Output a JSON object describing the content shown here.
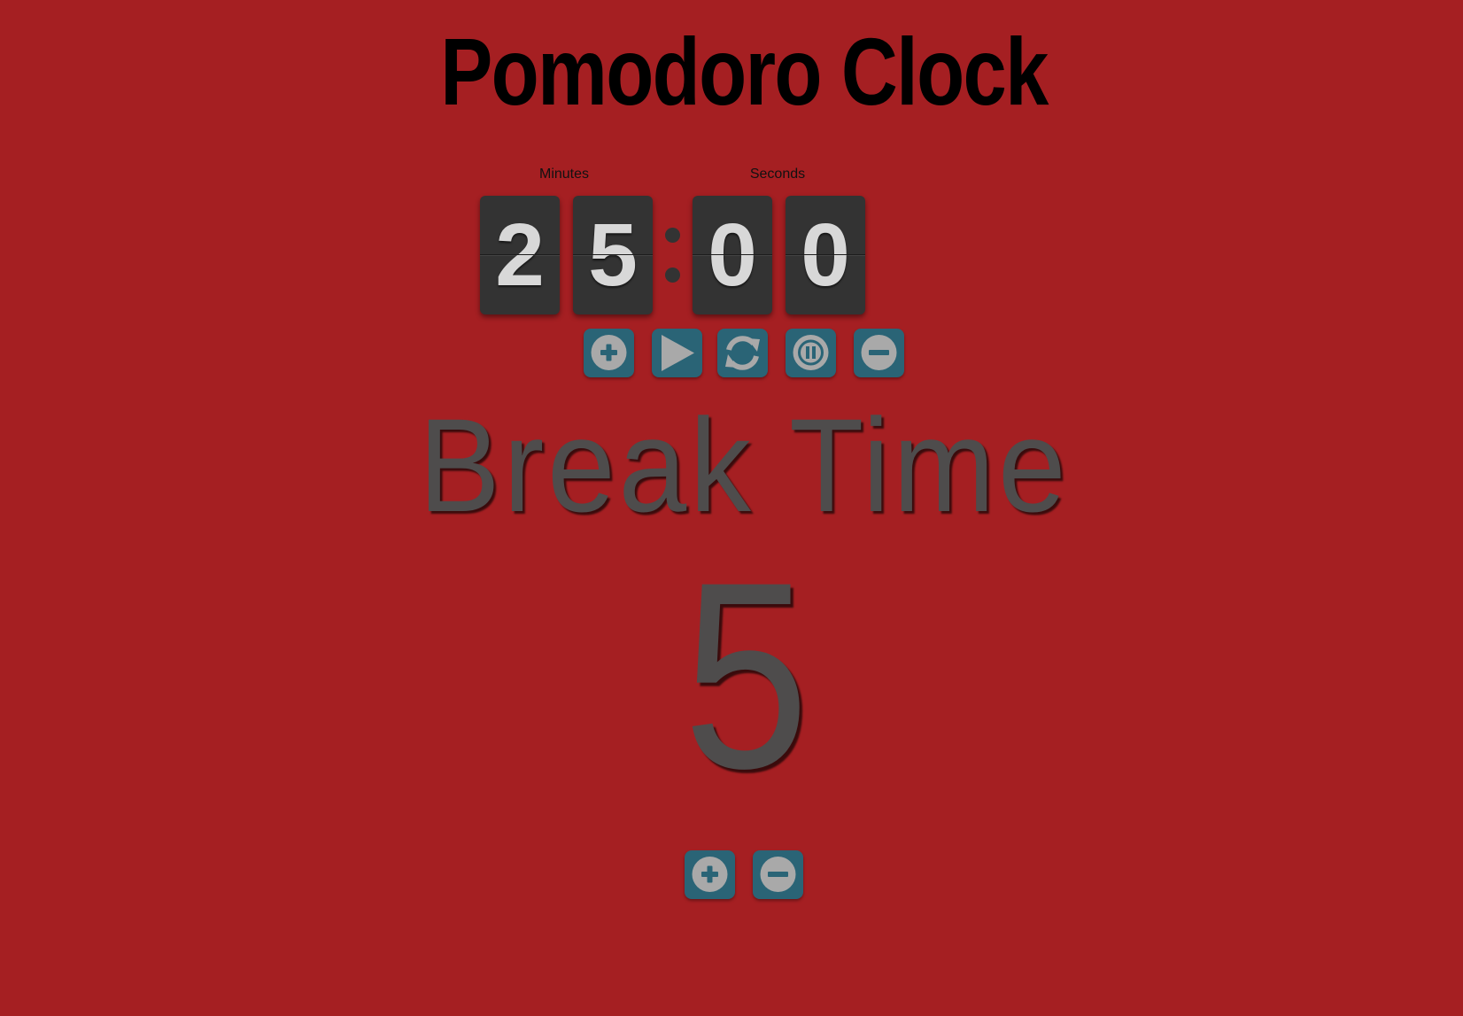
{
  "app": {
    "title": "Pomodoro Clock",
    "background_color": "#a51f22"
  },
  "timer": {
    "minutes_label": "Minutes",
    "seconds_label": "Seconds",
    "digits": [
      "2",
      "5",
      "0",
      "0"
    ],
    "separator": ":"
  },
  "controls": [
    {
      "name": "increase-session-button",
      "icon": "plus-circle-icon"
    },
    {
      "name": "start-button",
      "icon": "play-icon"
    },
    {
      "name": "reset-button",
      "icon": "refresh-icon"
    },
    {
      "name": "pause-button",
      "icon": "pause-circle-icon"
    },
    {
      "name": "decrease-session-button",
      "icon": "minus-circle-icon"
    }
  ],
  "break": {
    "title": "Break Time",
    "value": "5",
    "controls": [
      {
        "name": "increase-break-button",
        "icon": "plus-circle-icon"
      },
      {
        "name": "decrease-break-button",
        "icon": "minus-circle-icon"
      }
    ]
  },
  "colors": {
    "button_bg": "#2a6476",
    "icon_fill": "#a9a9a9",
    "digit_bg": "#333333",
    "digit_text": "#d8d8d8",
    "break_text": "#4e4c4c"
  }
}
